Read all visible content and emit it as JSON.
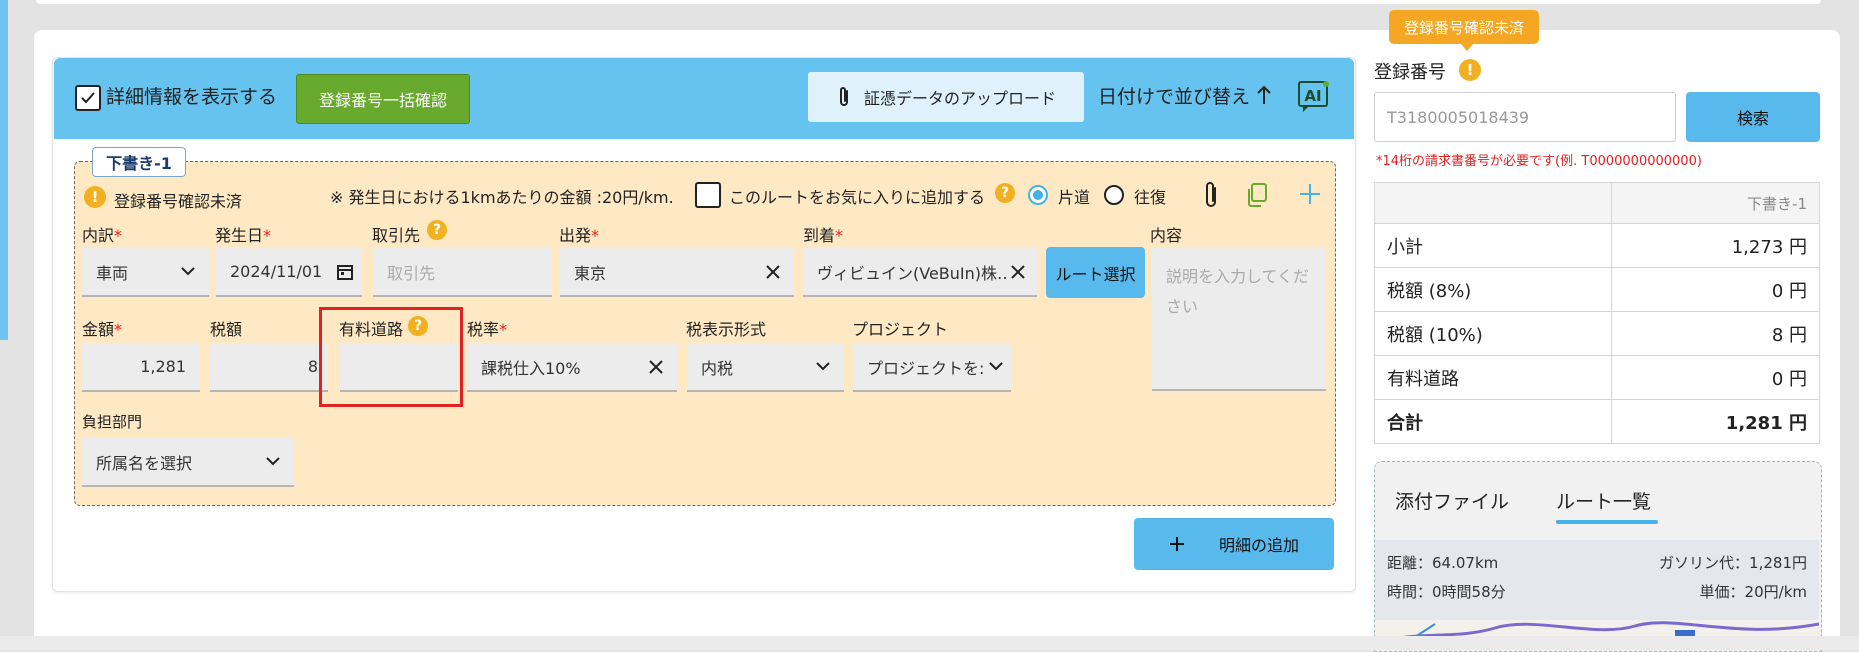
{
  "header": {
    "show_details_label": "詳細情報を表示する",
    "bulk_check_button": "登録番号一括確認",
    "upload_button": "証憑データのアップロード",
    "sort_label": "日付けで並び替え",
    "ai_icon_label": "AI"
  },
  "draft": {
    "tab_label": "下書き-1",
    "warning_text": "登録番号確認未済",
    "rate_note": "※ 発生日における1kmあたりの金額 :20円/km.",
    "favorite_label": "このルートをお気に入りに追加する",
    "one_way_label": "片道",
    "round_trip_label": "往復",
    "fields": {
      "category": {
        "label": "内訳",
        "value": "車両"
      },
      "date": {
        "label": "発生日",
        "value": "2024/11/01"
      },
      "client": {
        "label": "取引先",
        "placeholder": "取引先"
      },
      "departure": {
        "label": "出発",
        "value": "東京"
      },
      "arrival": {
        "label": "到着",
        "value": "ヴィビュイン(VeBuIn)株…"
      },
      "route_button": "ルート選択",
      "content": {
        "label": "内容",
        "placeholder": "説明を入力してください"
      },
      "amount": {
        "label": "金額",
        "value": "1,281"
      },
      "tax": {
        "label": "税額",
        "value": "8"
      },
      "toll": {
        "label": "有料道路",
        "value": ""
      },
      "tax_rate": {
        "label": "税率",
        "value": "課税仕入10%"
      },
      "tax_display": {
        "label": "税表示形式",
        "value": "内税"
      },
      "project": {
        "label": "プロジェクト",
        "value": "プロジェクトを:"
      },
      "department": {
        "label": "負担部門",
        "value": "所属名を選択"
      }
    },
    "add_line_button": "明細の追加"
  },
  "sidebar": {
    "tooltip": "登録番号確認未済",
    "reg_label": "登録番号",
    "reg_input_value": "T3180005018439",
    "search_button": "検索",
    "hint": "*14桁の請求書番号が必要です(例. T0000000000000)",
    "summary_header": "下書き-1",
    "summary_rows": [
      {
        "label": "小計",
        "value": "1,273 円"
      },
      {
        "label": "税額 (8%)",
        "value": "0 円"
      },
      {
        "label": "税額 (10%)",
        "value": "8 円"
      },
      {
        "label": "有料道路",
        "value": "0 円"
      },
      {
        "label": "合計",
        "value": "1,281 円"
      }
    ],
    "tabs": [
      "添付ファイル",
      "ルート一覧"
    ],
    "route_info": {
      "distance": "距離：64.07km",
      "gas": "ガソリン代：1,281円",
      "time": "時間：0時間58分",
      "unit_price": "単価：20円/km"
    }
  },
  "colors": {
    "header_blue": "#66c3ef",
    "green_button": "#67aa2d",
    "draft_bg": "#ffe9c4",
    "warning": "#f2b020",
    "highlight_red": "#e22222"
  }
}
